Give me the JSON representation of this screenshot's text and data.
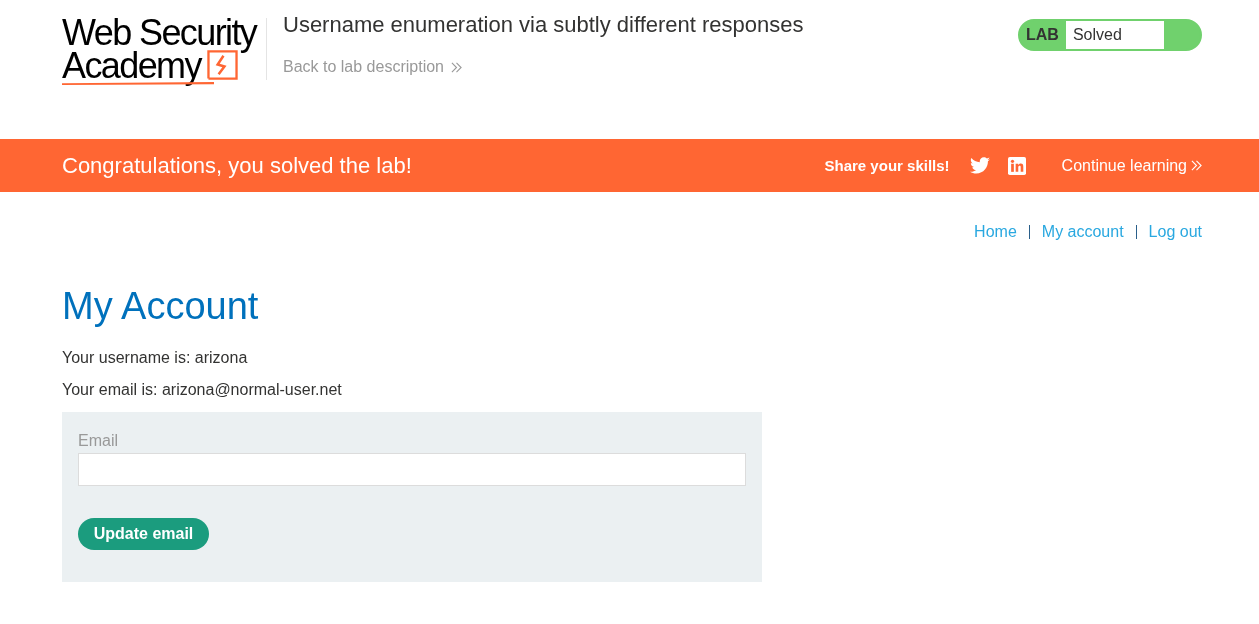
{
  "header": {
    "logo": {
      "line_1": "Web Security",
      "line_2": "Academy"
    },
    "lab_title": "Username enumeration via subtly different responses",
    "back_link": "Back to lab description",
    "lab_badge": {
      "label": "LAB",
      "status": "Solved",
      "solved": true
    }
  },
  "banner": {
    "message": "Congratulations, you solved the lab!",
    "share_label": "Share your skills!",
    "continue_link": "Continue learning"
  },
  "nav": {
    "links": [
      "Home",
      "My account",
      "Log out"
    ]
  },
  "page": {
    "heading": "My Account",
    "details": [
      "Your username is: arizona",
      "Your email is: arizona@normal-user.net"
    ],
    "form": {
      "label": "Email",
      "button": "Update email"
    }
  }
}
